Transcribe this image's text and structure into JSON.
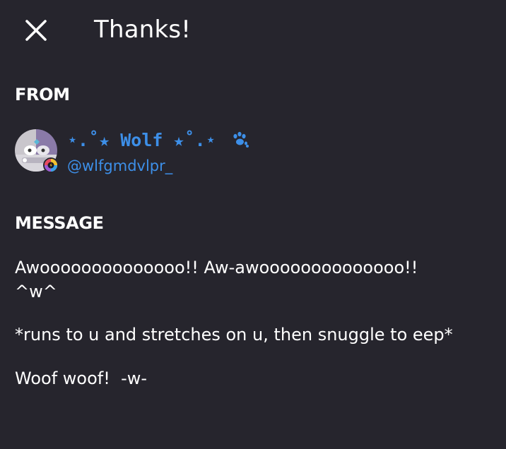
{
  "header": {
    "close_icon": "close-icon",
    "title": "Thanks!"
  },
  "from_section": {
    "label": "FROM",
    "user": {
      "display_name": "⋆.˚★ Wolf ★˚.⋆",
      "name_icon": "paw-icon",
      "handle": "@wlfgmdvlpr_",
      "name_color": "#3d8fe8",
      "avatar_icon": "avatar",
      "badge_icon": "badge-icon"
    }
  },
  "message_section": {
    "label": "MESSAGE",
    "paragraphs": [
      [
        "Awoooooooooooooo!! Aw-awoooooooooooooo!!",
        "^w^"
      ],
      [
        "*runs to u and stretches on u, then snuggle to eep*"
      ],
      [
        "Woof woof!  -w-"
      ]
    ]
  },
  "colors": {
    "background": "#26252d",
    "text": "#ffffff",
    "accent": "#3d8fe8"
  }
}
